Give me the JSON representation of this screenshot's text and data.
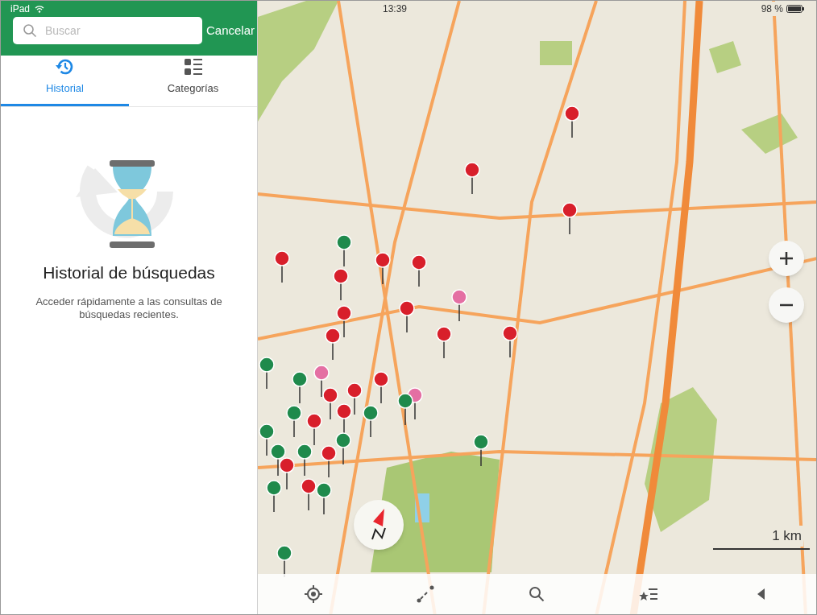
{
  "status_bar": {
    "device": "iPad",
    "time": "13:39",
    "battery": "98 %"
  },
  "search": {
    "placeholder": "Buscar",
    "cancel": "Cancelar"
  },
  "tabs": [
    {
      "label": "Historial",
      "selected": true
    },
    {
      "label": "Categorías",
      "selected": false
    }
  ],
  "empty_state": {
    "title": "Historial de búsquedas",
    "message": "Acceder rápidamente a las consultas de búsquedas recientes."
  },
  "map": {
    "scale": "1 km"
  }
}
